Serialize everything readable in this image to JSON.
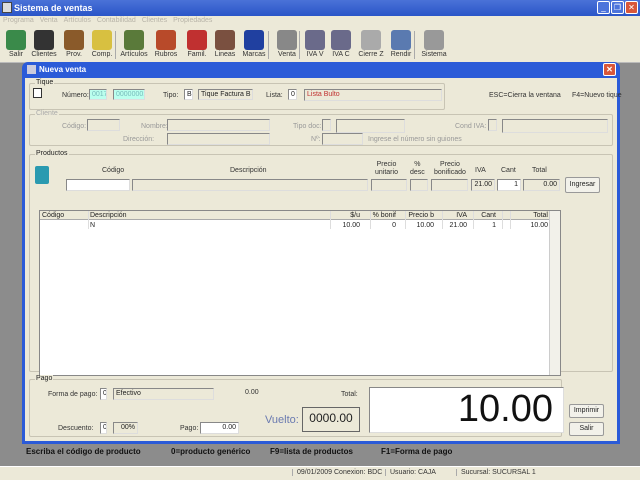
{
  "app": {
    "title": "Sistema de ventas"
  },
  "menu": [
    "Programa",
    "Venta",
    "Artículos",
    "Contabilidad",
    "Clientes",
    "Propiedades"
  ],
  "toolbar": [
    {
      "label": "Salir",
      "icon": "exit-icon",
      "color": "#3a8a4a"
    },
    {
      "label": "Clientes",
      "icon": "client-icon",
      "color": "#333"
    },
    {
      "label": "Prov.",
      "icon": "truck-icon",
      "color": "#8a5a2a"
    },
    {
      "label": "Comp.",
      "icon": "purchase-icon",
      "color": "#d8c040"
    },
    {
      "label": "Artículos",
      "icon": "articles-icon",
      "color": "#5a7a3a"
    },
    {
      "label": "Rubros",
      "icon": "categories-icon",
      "color": "#b84a2a"
    },
    {
      "label": "Famil.",
      "icon": "family-icon",
      "color": "#c03030"
    },
    {
      "label": "Lineas",
      "icon": "lines-icon",
      "color": "#7a5040"
    },
    {
      "label": "Marcas",
      "icon": "brands-icon",
      "color": "#2040a0"
    },
    {
      "label": "Venta",
      "icon": "cart-icon",
      "color": "#888"
    },
    {
      "label": "IVA V",
      "icon": "book-v-icon",
      "color": "#6a6a8a"
    },
    {
      "label": "IVA C",
      "icon": "book-c-icon",
      "color": "#6a6a8a"
    },
    {
      "label": "Cierre Z",
      "icon": "register-icon",
      "color": "#aaa"
    },
    {
      "label": "Rendir",
      "icon": "report-icon",
      "color": "#5a7ab0"
    },
    {
      "label": "Sistema",
      "icon": "system-icon",
      "color": "#999"
    }
  ],
  "dialog": {
    "title": "Nueva venta",
    "tique": {
      "legend": "Tique",
      "numero_label": "Número:",
      "numero_pv": "0017",
      "numero": "00000001",
      "tipo_label": "Tipo:",
      "tipo": "B",
      "tipo_desc": "Tique Factura B",
      "lista_label": "Lista:",
      "lista": "0",
      "lista_desc": "Lista Bulto",
      "shortcut1": "ESC=Cierra la ventana",
      "shortcut2": "F4=Nuevo tique"
    },
    "cliente": {
      "legend": "Cliente",
      "codigo": "Código:",
      "nombre": "Nombre:",
      "direccion": "Dirección:",
      "tipo_doc": "Tipo doc:",
      "nro": "Nº:",
      "hint": "Ingrese el número sin guiones",
      "cond_iva": "Cond IVA:"
    },
    "productos": {
      "legend": "Productos",
      "codigo": "Código",
      "descripcion": "Descripción",
      "precio_unitario": [
        "Precio",
        "unitario"
      ],
      "desc": [
        "%",
        "desc"
      ],
      "precio_bonif": [
        "Precio",
        "bonificado"
      ],
      "iva": "IVA",
      "cant": "Cant",
      "total": "Total",
      "iva_val": "21.00",
      "cant_val": "1",
      "total_val": "0.00",
      "ingresar": "Ingresar",
      "grid_headers": [
        "Código",
        "Descripción",
        "$/u",
        "% bonif",
        "Precio b",
        "IVA",
        "Cant",
        "Total"
      ],
      "rows": [
        [
          "",
          "N",
          "10.00",
          "0",
          "10.00",
          "21.00",
          "1",
          "10.00"
        ]
      ]
    },
    "pago": {
      "legend": "Pago",
      "forma_label": "Forma de pago:",
      "forma": "0",
      "forma_desc": "Efectivo",
      "monto": "0.00",
      "total_label": "Total:",
      "total": "10.00",
      "vuelto_label": "Vuelto:",
      "vuelto": "0000.00",
      "descuento_label": "Descuento:",
      "descuento": "0",
      "descuento_pct": "00%",
      "pago_label": "Pago:",
      "pago": "0.00"
    },
    "imprimir": "Imprimir",
    "salir": "Salir",
    "hints": [
      "Escriba el código de producto",
      "0=producto genérico",
      "F9=lista de productos",
      "F1=Forma de pago"
    ]
  },
  "status": {
    "date": "09/01/2009",
    "conexion": "Conexion: BDC",
    "usuario": "Usuario: CAJA",
    "sucursal": "Sucursal: SUCURSAL 1"
  }
}
